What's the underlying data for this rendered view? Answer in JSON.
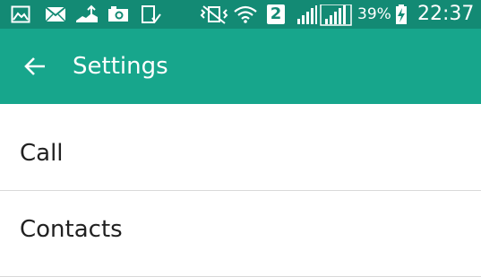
{
  "status_bar": {
    "icons": [
      "gallery-icon",
      "mail-icon",
      "upload-icon",
      "camera-icon",
      "clipboard-check-icon",
      "vibrate-mute-icon",
      "wifi-icon",
      "signal-icon"
    ],
    "sim_label": "2",
    "battery_percent": "39%",
    "time": "22:37"
  },
  "app_bar": {
    "back_icon": "arrow-back-icon",
    "title": "Settings"
  },
  "settings_list": {
    "items": [
      {
        "label": "Call"
      },
      {
        "label": "Contacts"
      }
    ]
  },
  "colors": {
    "status_bar_bg": "#138a74",
    "app_bar_bg": "#17a68c",
    "divider": "#d9d9d9",
    "text_primary": "#212121"
  }
}
